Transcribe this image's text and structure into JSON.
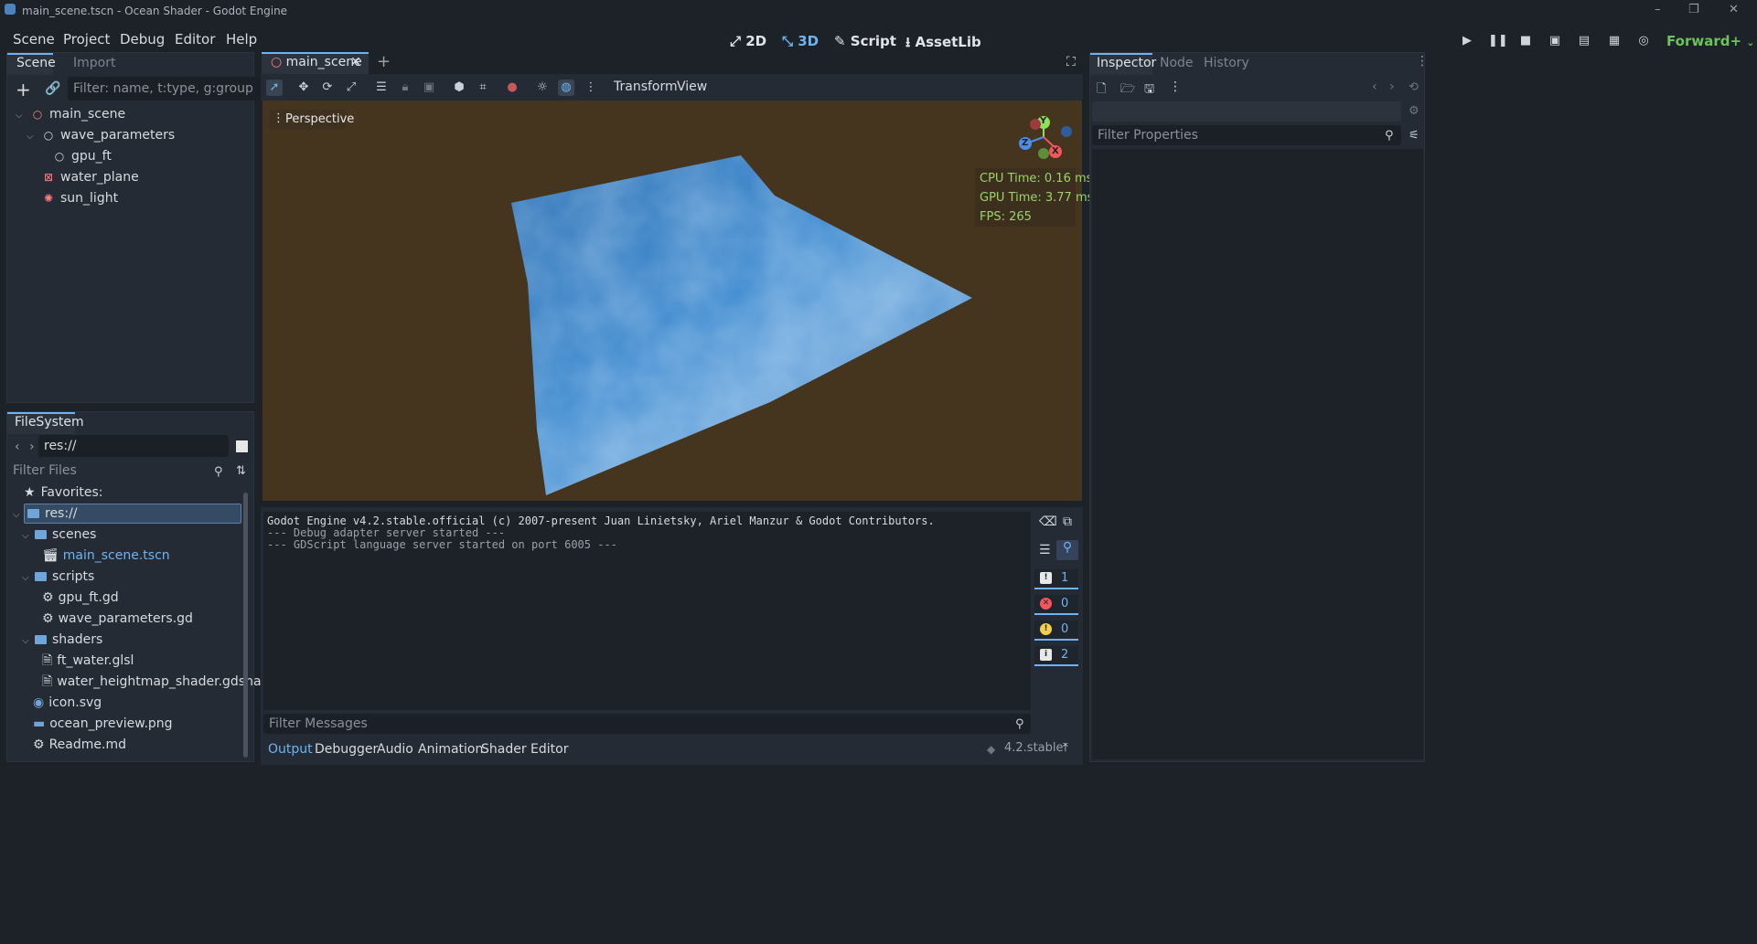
{
  "window": {
    "title": "main_scene.tscn - Ocean Shader - Godot Engine",
    "controls": [
      "–",
      "❐",
      "✕"
    ]
  },
  "menu": [
    "Scene",
    "Project",
    "Debug",
    "Editor",
    "Help"
  ],
  "workspaces": [
    {
      "label": "2D",
      "icon": "2d-icon"
    },
    {
      "label": "3D",
      "icon": "3d-icon",
      "active": true
    },
    {
      "label": "Script",
      "icon": "script-icon"
    },
    {
      "label": "AssetLib",
      "icon": "assetlib-icon"
    }
  ],
  "renderer": "Forward+",
  "scene_dock": {
    "tabs": [
      "Scene",
      "Import"
    ],
    "filter_placeholder": "Filter: name, t:type, g:group",
    "nodes": [
      {
        "label": "main_scene",
        "icon": "node3d-icon"
      },
      {
        "label": "wave_parameters",
        "icon": "node-icon"
      },
      {
        "label": "gpu_ft",
        "icon": "node-icon"
      },
      {
        "label": "water_plane",
        "icon": "mesh-icon"
      },
      {
        "label": "sun_light",
        "icon": "light-icon"
      }
    ]
  },
  "filesystem": {
    "tab": "FileSystem",
    "path": "res://",
    "filter_placeholder": "Filter Files",
    "favorites": "Favorites:",
    "items": [
      {
        "label": "res://"
      },
      {
        "label": "scenes"
      },
      {
        "label": "main_scene.tscn"
      },
      {
        "label": "scripts"
      },
      {
        "label": "gpu_ft.gd"
      },
      {
        "label": "wave_parameters.gd"
      },
      {
        "label": "shaders"
      },
      {
        "label": "ft_water.glsl"
      },
      {
        "label": "water_heightmap_shader.gdshader"
      },
      {
        "label": "icon.svg"
      },
      {
        "label": "ocean_preview.png"
      },
      {
        "label": "Readme.md"
      }
    ]
  },
  "editor_tab": "main_scene",
  "viewport_toolbar": {
    "transform": "Transform",
    "view": "View"
  },
  "viewport": {
    "perspective_label": "Perspective",
    "cpu_time": "CPU Time: 0.16 ms",
    "gpu_time": "GPU Time: 3.77 ms",
    "fps": "FPS: 265",
    "gizmo": {
      "y": "Y",
      "x": "X",
      "z": "Z"
    }
  },
  "output": {
    "lines": [
      "Godot Engine v4.2.stable.official (c) 2007-present Juan Linietsky, Ariel Manzur & Godot Contributors.",
      "--- Debug adapter server started ---",
      "--- GDScript language server started on port 6005 ---"
    ],
    "filter_placeholder": "Filter Messages",
    "counts": {
      "messages": "1",
      "errors": "0",
      "warnings": "0",
      "info": "2"
    }
  },
  "bottom_tabs": [
    "Output",
    "Debugger",
    "Audio",
    "Animation",
    "Shader Editor"
  ],
  "version": "4.2.stable",
  "inspector": {
    "tabs": [
      "Inspector",
      "Node",
      "History"
    ],
    "filter_placeholder": "Filter Properties"
  },
  "colors": {
    "accent": "#6fb3f2",
    "ocean": "#2f7fc4",
    "viewport_bg": "#45351f",
    "stats": "#9bd36a"
  }
}
